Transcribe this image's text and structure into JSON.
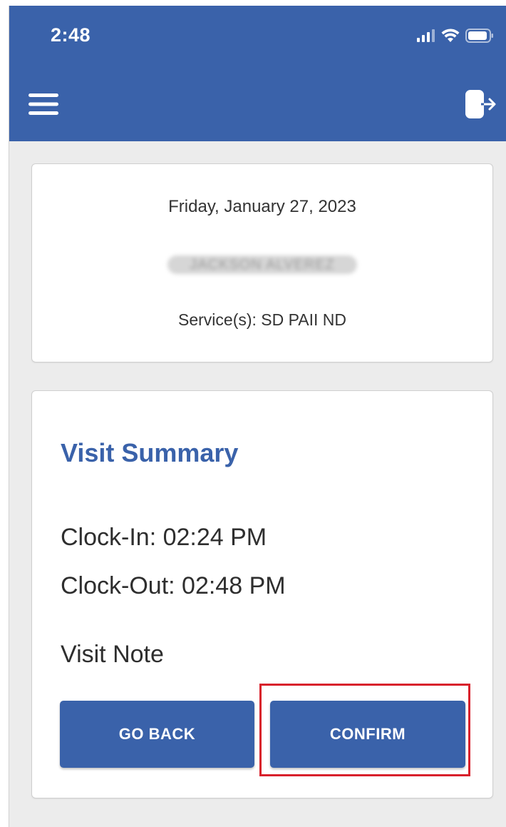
{
  "status_bar": {
    "time": "2:48",
    "icons": [
      "cellular-signal-icon",
      "wifi-icon",
      "battery-icon"
    ]
  },
  "header": {
    "menu_icon": "hamburger-menu-icon",
    "logout_icon": "logout-icon",
    "background_color": "#3a62aa"
  },
  "visit_info": {
    "date": "Friday, January 27, 2023",
    "client_name": "JACKSON ALVEREZ",
    "services": "Service(s): SD PAII ND"
  },
  "visit_summary": {
    "title": "Visit Summary",
    "clock_in": "Clock-In: 02:24 PM",
    "clock_out": "Clock-Out: 02:48 PM",
    "visit_note_label": "Visit Note"
  },
  "actions": {
    "go_back_label": "GO BACK",
    "confirm_label": "CONFIRM"
  },
  "colors": {
    "accent": "#3a62aa",
    "highlight": "#d8202b",
    "page_background": "#ececec"
  }
}
